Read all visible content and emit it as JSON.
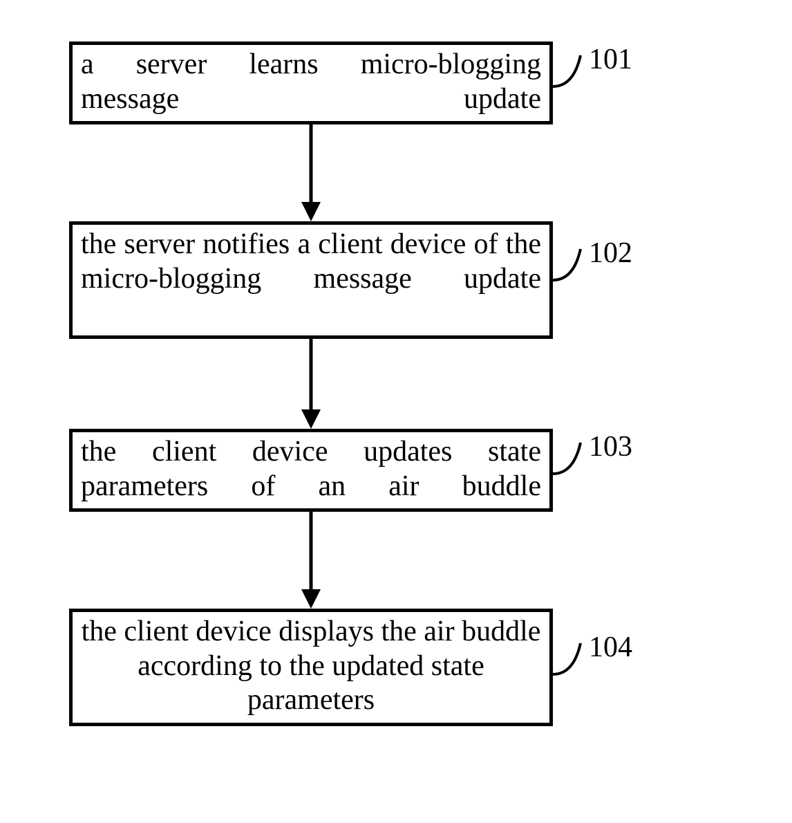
{
  "nodes": {
    "n101": {
      "label": "101",
      "text": "a server learns micro-blogging message update"
    },
    "n102": {
      "label": "102",
      "text": "the server notifies a client device of the micro-blogging message update"
    },
    "n103": {
      "label": "103",
      "text": "the client device updates state parameters of an air buddle"
    },
    "n104": {
      "label": "104",
      "text": "the client device displays the air buddle according to the updated state parameters"
    }
  }
}
